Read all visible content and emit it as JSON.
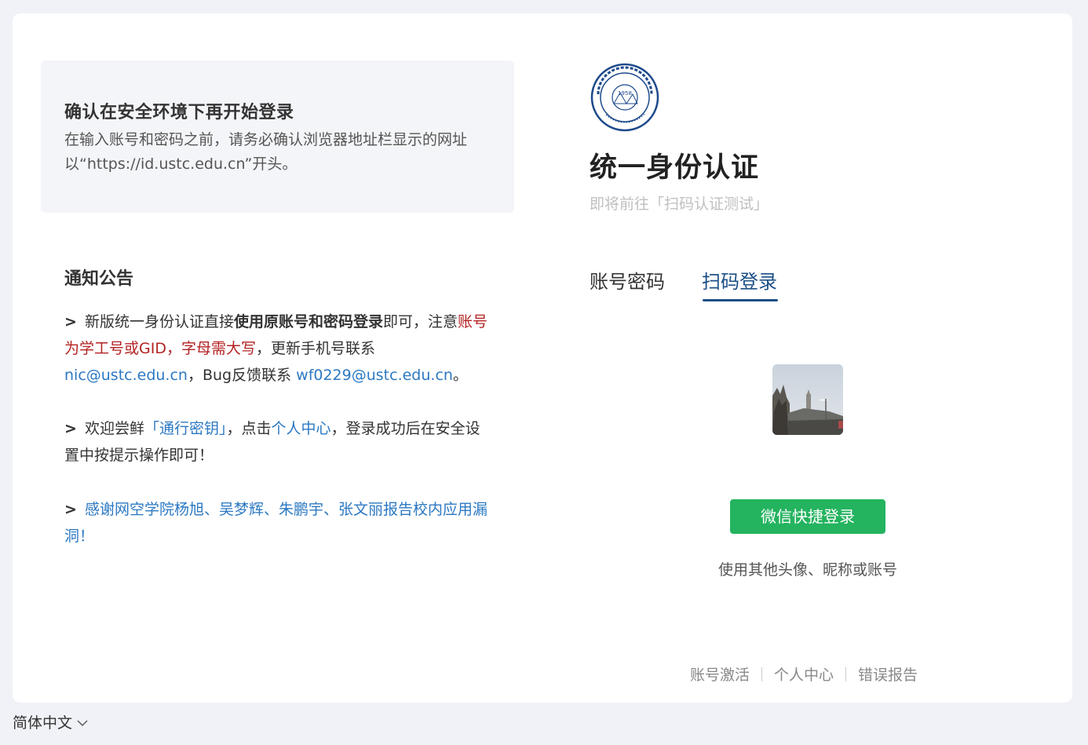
{
  "notice": {
    "title": "确认在安全环境下再开始登录",
    "text": "在输入账号和密码之前，请务必确认浏览器地址栏显示的网址以“https://id.ustc.edu.cn”开头。"
  },
  "announcements": {
    "title": "通知公告",
    "marker": ">",
    "item1": {
      "p1": "新版统一身份认证直接",
      "p2": "使用原账号和密码登录",
      "p3": "即可，注意",
      "p4": "账号为学工号或GID，字母需大写",
      "p5": "，更新手机号联系",
      "p6": "nic@ustc.edu.cn",
      "p7": "，Bug反馈联系 ",
      "p8": "wf0229@ustc.edu.cn",
      "p9": "。"
    },
    "item2": {
      "p1": "欢迎尝鲜",
      "p2": "「通行密钥」",
      "p3": "，点击",
      "p4": "个人中心",
      "p5": "，登录成功后在安全设置中按提示操作即可！"
    },
    "item3": {
      "p1": "感谢网空学院杨旭、吴梦辉、朱鹏宇、张文丽报告校内应用漏洞！"
    }
  },
  "logo": {
    "icon": "ustc-seal-logo",
    "year": "1958"
  },
  "login": {
    "title": "统一身份认证",
    "subtitle": "即将前往「扫码认证测试」",
    "tabs": [
      "账号密码",
      "扫码登录"
    ],
    "active_tab": "扫码登录",
    "wechat_button": "微信快捷登录",
    "other_account": "使用其他头像、昵称或账号"
  },
  "footer": {
    "links": [
      "账号激活",
      "个人中心",
      "错误报告"
    ]
  },
  "language": {
    "current": "简体中文",
    "icon": "chevron-down-icon"
  },
  "colors": {
    "accent": "#1c4f86",
    "wechat_green": "#24b35f",
    "warning_red": "#b42222",
    "link_blue": "#2b78c2",
    "page_bg": "#f1f2f7"
  }
}
